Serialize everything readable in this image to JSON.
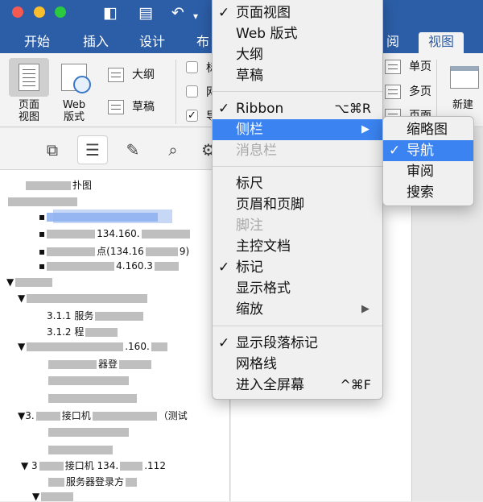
{
  "titlebar": {
    "icons": [
      "sidebar-toggle-icon",
      "save-icon",
      "undo-icon",
      "undo-dropdown-icon"
    ]
  },
  "tabs": [
    {
      "label": "开始"
    },
    {
      "label": "插入"
    },
    {
      "label": "设计"
    },
    {
      "label": "布"
    },
    {
      "label": "阅"
    },
    {
      "label": "视图"
    }
  ],
  "ribbon": {
    "page_view": "页面\n视图",
    "web_view": "Web\n版式",
    "outline": "大纲",
    "draft": "草稿",
    "check_labels": [
      "标",
      "网",
      "导"
    ],
    "single_page": "单页",
    "multi_page": "多页",
    "page_width": "页面",
    "new_window": "新建"
  },
  "view_menu": {
    "items": [
      {
        "label": "页面视图",
        "checked": true
      },
      {
        "label": "Web 版式"
      },
      {
        "label": "大纲"
      },
      {
        "label": "草稿"
      },
      {
        "label": "Ribbon",
        "checked": true,
        "shortcut": "⌥⌘R"
      },
      {
        "label": "侧栏",
        "submenu": true,
        "highlighted": true
      },
      {
        "label": "消息栏",
        "disabled": true
      },
      {
        "label": "标尺"
      },
      {
        "label": "页眉和页脚"
      },
      {
        "label": "脚注",
        "disabled": true
      },
      {
        "label": "主控文档"
      },
      {
        "label": "标记",
        "checked": true
      },
      {
        "label": "显示格式"
      },
      {
        "label": "缩放",
        "submenu": true
      },
      {
        "label": "显示段落标记",
        "checked": true
      },
      {
        "label": "网格线"
      },
      {
        "label": "进入全屏幕",
        "shortcut": "^⌘F"
      }
    ]
  },
  "sidebar_submenu": {
    "items": [
      {
        "label": "缩略图"
      },
      {
        "label": "导航",
        "checked": true,
        "highlighted": true
      },
      {
        "label": "审阅"
      },
      {
        "label": "搜索"
      }
    ]
  },
  "nav_pane": {
    "lines": [
      {
        "text": "扑图"
      },
      {
        "text": ""
      },
      {
        "text": ""
      },
      {
        "text": "134.160."
      },
      {
        "text": "点(134.16"
      },
      {
        "text": "4.160.3"
      },
      {
        "text": ""
      },
      {
        "text": ""
      },
      {
        "text": "3.1.1 服务"
      },
      {
        "text": "3.1.2 程"
      },
      {
        "text": ".160."
      },
      {
        "text": "器登"
      },
      {
        "text": ""
      },
      {
        "text": ""
      },
      {
        "text": "3.",
        "text2": "接口机",
        "text3": "（测试"
      },
      {
        "text": ""
      },
      {
        "text": ""
      },
      {
        "text": "接口机  134.",
        "text2": ".112"
      },
      {
        "text": "服务器登录方"
      }
    ],
    "check_glyph": "✓"
  }
}
